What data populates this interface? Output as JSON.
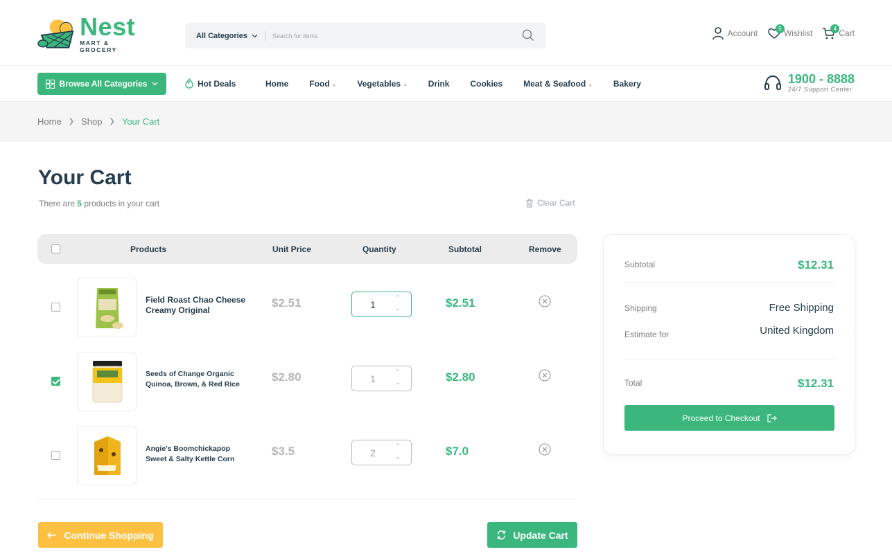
{
  "brand": {
    "name": "Nest",
    "tagline": "MART & GROCERY"
  },
  "search": {
    "category": "All Categories",
    "placeholder": "Search for items"
  },
  "header_actions": {
    "account": "Account",
    "wishlist": "Wishlist",
    "wishlist_count": "5",
    "cart": "Cart",
    "cart_count": "4"
  },
  "nav": {
    "browse": "Browse All Categories",
    "hot_deals": "Hot Deals",
    "links": [
      "Home",
      "Food",
      "Vegetables",
      "Drink",
      "Cookies",
      "Meat & Seafood",
      "Bakery"
    ],
    "support_phone": "1900 - 8888",
    "support_label": "24/7 Support Center"
  },
  "breadcrumb": [
    "Home",
    "Shop",
    "Your Cart"
  ],
  "cart": {
    "title": "Your Cart",
    "count_prefix": "There are ",
    "count": "5",
    "count_suffix": " products in your cart",
    "clear": "Clear Cart",
    "columns": {
      "products": "Products",
      "unit_price": "Unit Price",
      "quantity": "Quantity",
      "subtotal": "Subtotal",
      "remove": "Remove"
    },
    "items": [
      {
        "name_line1": "Field Roast Chao Cheese",
        "name_line2": "Creamy Original",
        "price": "$2.51",
        "qty": "1",
        "subtotal": "$2.51",
        "checked": false,
        "active": true
      },
      {
        "name_line1": "Seeds of Change Organic",
        "name_line2": "Quinoa, Brown, & Red Rice",
        "price": "$2.80",
        "qty": "1",
        "subtotal": "$2.80",
        "checked": true,
        "active": false
      },
      {
        "name_line1": "Angie's Boomchickapop",
        "name_line2": "Sweet & Salty Kettle Corn",
        "price": "$3.5",
        "qty": "2",
        "subtotal": "$7.0",
        "checked": false,
        "active": false
      }
    ],
    "continue": "Continue Shopping",
    "update": "Update Cart"
  },
  "summary": {
    "subtotal_label": "Subtotal",
    "subtotal": "$12.31",
    "shipping_label": "Shipping",
    "shipping": "Free Shipping",
    "estimate_label": "Estimate for",
    "estimate": "United Kingdom",
    "total_label": "Total",
    "total": "$12.31",
    "checkout": "Proceed to Checkout"
  },
  "colors": {
    "brand": "#3BB77E",
    "heading": "#253D4E",
    "muted": "#7E7E7E",
    "accent": "#FDC040"
  }
}
